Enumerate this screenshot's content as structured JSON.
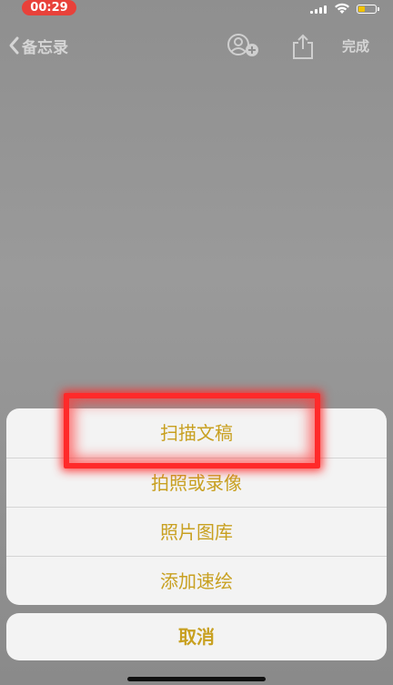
{
  "status_bar": {
    "time": "00:29",
    "battery_level": 0.4,
    "accent": "#e8413a"
  },
  "nav": {
    "back_label": "备忘录",
    "back_icon": "chevron-left-icon",
    "collab_icon": "person-add-icon",
    "share_icon": "share-icon",
    "done_label": "完成"
  },
  "action_sheet": {
    "items": [
      {
        "label": "扫描文稿",
        "highlighted": true
      },
      {
        "label": "拍照或录像"
      },
      {
        "label": "照片图库"
      },
      {
        "label": "添加速绘"
      }
    ],
    "cancel_label": "取消",
    "text_color": "#c8a020",
    "highlight_color": "#ff2a2a"
  }
}
